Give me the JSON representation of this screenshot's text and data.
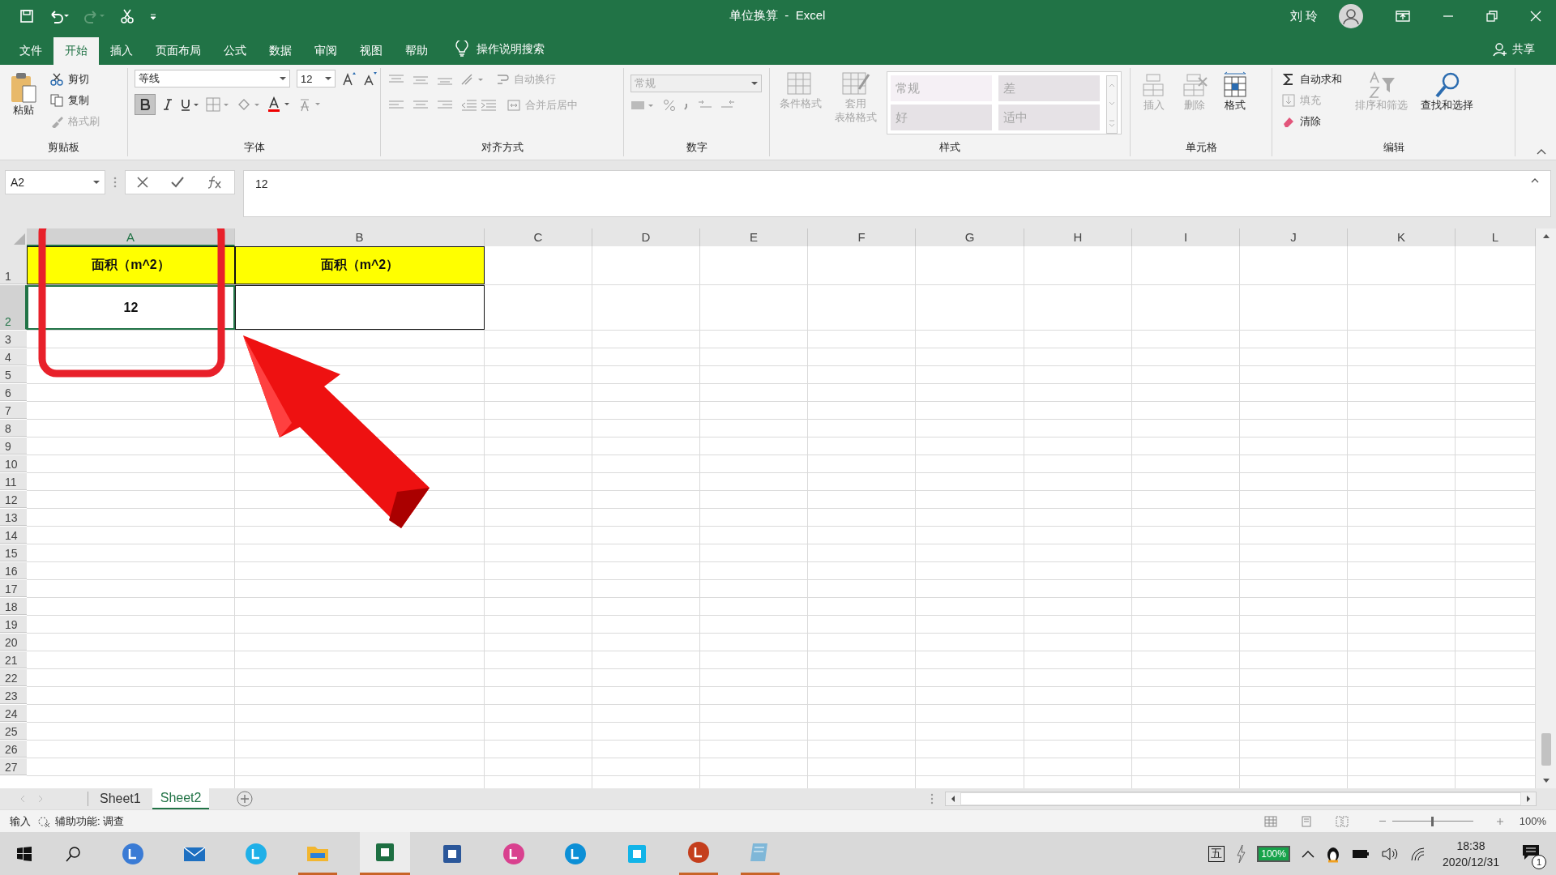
{
  "window": {
    "title": "单位换算  -  Excel",
    "user": "刘 玲"
  },
  "menu_tabs": [
    {
      "label": "文件",
      "selected": false
    },
    {
      "label": "开始",
      "selected": true
    },
    {
      "label": "插入",
      "selected": false
    },
    {
      "label": "页面布局",
      "selected": false
    },
    {
      "label": "公式",
      "selected": false
    },
    {
      "label": "数据",
      "selected": false
    },
    {
      "label": "审阅",
      "selected": false
    },
    {
      "label": "视图",
      "selected": false
    },
    {
      "label": "帮助",
      "selected": false
    }
  ],
  "tell_me": "操作说明搜索",
  "share": "共享",
  "ribbon": {
    "clipboard": {
      "label": "剪贴板",
      "buttons": [
        {
          "label": "粘贴",
          "disabled": false
        },
        {
          "label": "剪切",
          "disabled": false
        },
        {
          "label": "复制",
          "disabled": false
        },
        {
          "label": "格式刷",
          "disabled": true
        }
      ]
    },
    "font": {
      "label": "字体",
      "font_name": "等线",
      "font_size": "12",
      "bold_selected": true
    },
    "alignment": {
      "label": "对齐方式",
      "buttons": [
        {
          "label": "自动换行",
          "disabled": true
        },
        {
          "label": "合并后居中",
          "disabled": true
        }
      ]
    },
    "number": {
      "label": "数字",
      "format": "常规",
      "disabled": true
    },
    "styles": {
      "label": "样式",
      "buttons": [
        {
          "lines": [
            "条件格式"
          ],
          "disabled": true
        },
        {
          "lines": [
            "套用",
            "表格格式"
          ],
          "disabled": true
        }
      ],
      "gallery": [
        "常规",
        "差",
        "好",
        "适中"
      ]
    },
    "cells": {
      "label": "单元格",
      "buttons": [
        {
          "label": "插入",
          "disabled": true
        },
        {
          "label": "删除",
          "disabled": true
        },
        {
          "label": "格式",
          "disabled": false
        }
      ]
    },
    "editing": {
      "label": "编辑",
      "buttons": [
        {
          "label": "自动求和",
          "disabled": false
        },
        {
          "label": "填充",
          "disabled": true
        },
        {
          "label": "清除",
          "disabled": false
        },
        {
          "label": "排序和筛选",
          "disabled": true
        },
        {
          "label": "查找和选择",
          "disabled": false
        }
      ]
    }
  },
  "name_box": "A2",
  "formula": "12",
  "columns": [
    {
      "label": "A",
      "selected": true
    },
    {
      "label": "B",
      "selected": false
    },
    {
      "label": "C",
      "selected": false
    },
    {
      "label": "D",
      "selected": false
    },
    {
      "label": "E",
      "selected": false
    },
    {
      "label": "F",
      "selected": false
    },
    {
      "label": "G",
      "selected": false
    },
    {
      "label": "H",
      "selected": false
    },
    {
      "label": "I",
      "selected": false
    },
    {
      "label": "J",
      "selected": false
    },
    {
      "label": "K",
      "selected": false
    },
    {
      "label": "L",
      "selected": false
    }
  ],
  "rows": [
    {
      "header": "1",
      "selected": false,
      "cells": [
        {
          "text": "面积（m^2）",
          "highlight": true,
          "selected": false
        },
        {
          "text": "面积（m^2）",
          "highlight": true,
          "selected": false
        }
      ]
    },
    {
      "header": "2",
      "selected": true,
      "cells": [
        {
          "text": "12",
          "highlight": false,
          "selected": true
        },
        {
          "highlight": false,
          "selected": false
        }
      ]
    },
    {
      "header": "3",
      "selected": false
    },
    {
      "header": "4",
      "selected": false
    },
    {
      "header": "5",
      "selected": false
    },
    {
      "header": "6",
      "selected": false
    },
    {
      "header": "7",
      "selected": false
    },
    {
      "header": "8",
      "selected": false
    },
    {
      "header": "9",
      "selected": false
    },
    {
      "header": "10",
      "selected": false
    },
    {
      "header": "11",
      "selected": false
    },
    {
      "header": "12",
      "selected": false
    },
    {
      "header": "13",
      "selected": false
    },
    {
      "header": "14",
      "selected": false
    },
    {
      "header": "15",
      "selected": false
    },
    {
      "header": "16",
      "selected": false
    },
    {
      "header": "17",
      "selected": false
    },
    {
      "header": "18",
      "selected": false
    },
    {
      "header": "19",
      "selected": false
    },
    {
      "header": "20",
      "selected": false
    },
    {
      "header": "21",
      "selected": false
    },
    {
      "header": "22",
      "selected": false
    },
    {
      "header": "23",
      "selected": false
    },
    {
      "header": "24",
      "selected": false
    },
    {
      "header": "25",
      "selected": false
    },
    {
      "header": "26",
      "selected": false
    },
    {
      "header": "27",
      "selected": false
    }
  ],
  "sheets": [
    {
      "label": "Sheet1",
      "selected": false
    },
    {
      "label": "Sheet2",
      "selected": true
    }
  ],
  "status_bar": {
    "mode": "输入",
    "accessibility": "辅助功能: 调查",
    "zoom_slider": {
      "level": 0.5
    },
    "zoom": "100%"
  },
  "taskbar": {
    "apps": [
      {
        "open": false,
        "active": false
      },
      {
        "open": false,
        "active": false
      },
      {
        "open": false,
        "active": false
      },
      {
        "open": true,
        "active": false
      },
      {
        "open": true,
        "active": true
      },
      {
        "open": false,
        "active": false
      },
      {
        "open": false,
        "active": false
      },
      {
        "open": false,
        "active": false
      },
      {
        "open": false,
        "active": false
      },
      {
        "open": true,
        "active": false
      },
      {
        "open": true,
        "active": false
      }
    ],
    "ime": "五",
    "battery": "100%",
    "time": "18:38",
    "date": "2020/12/31",
    "notifications": "1"
  }
}
